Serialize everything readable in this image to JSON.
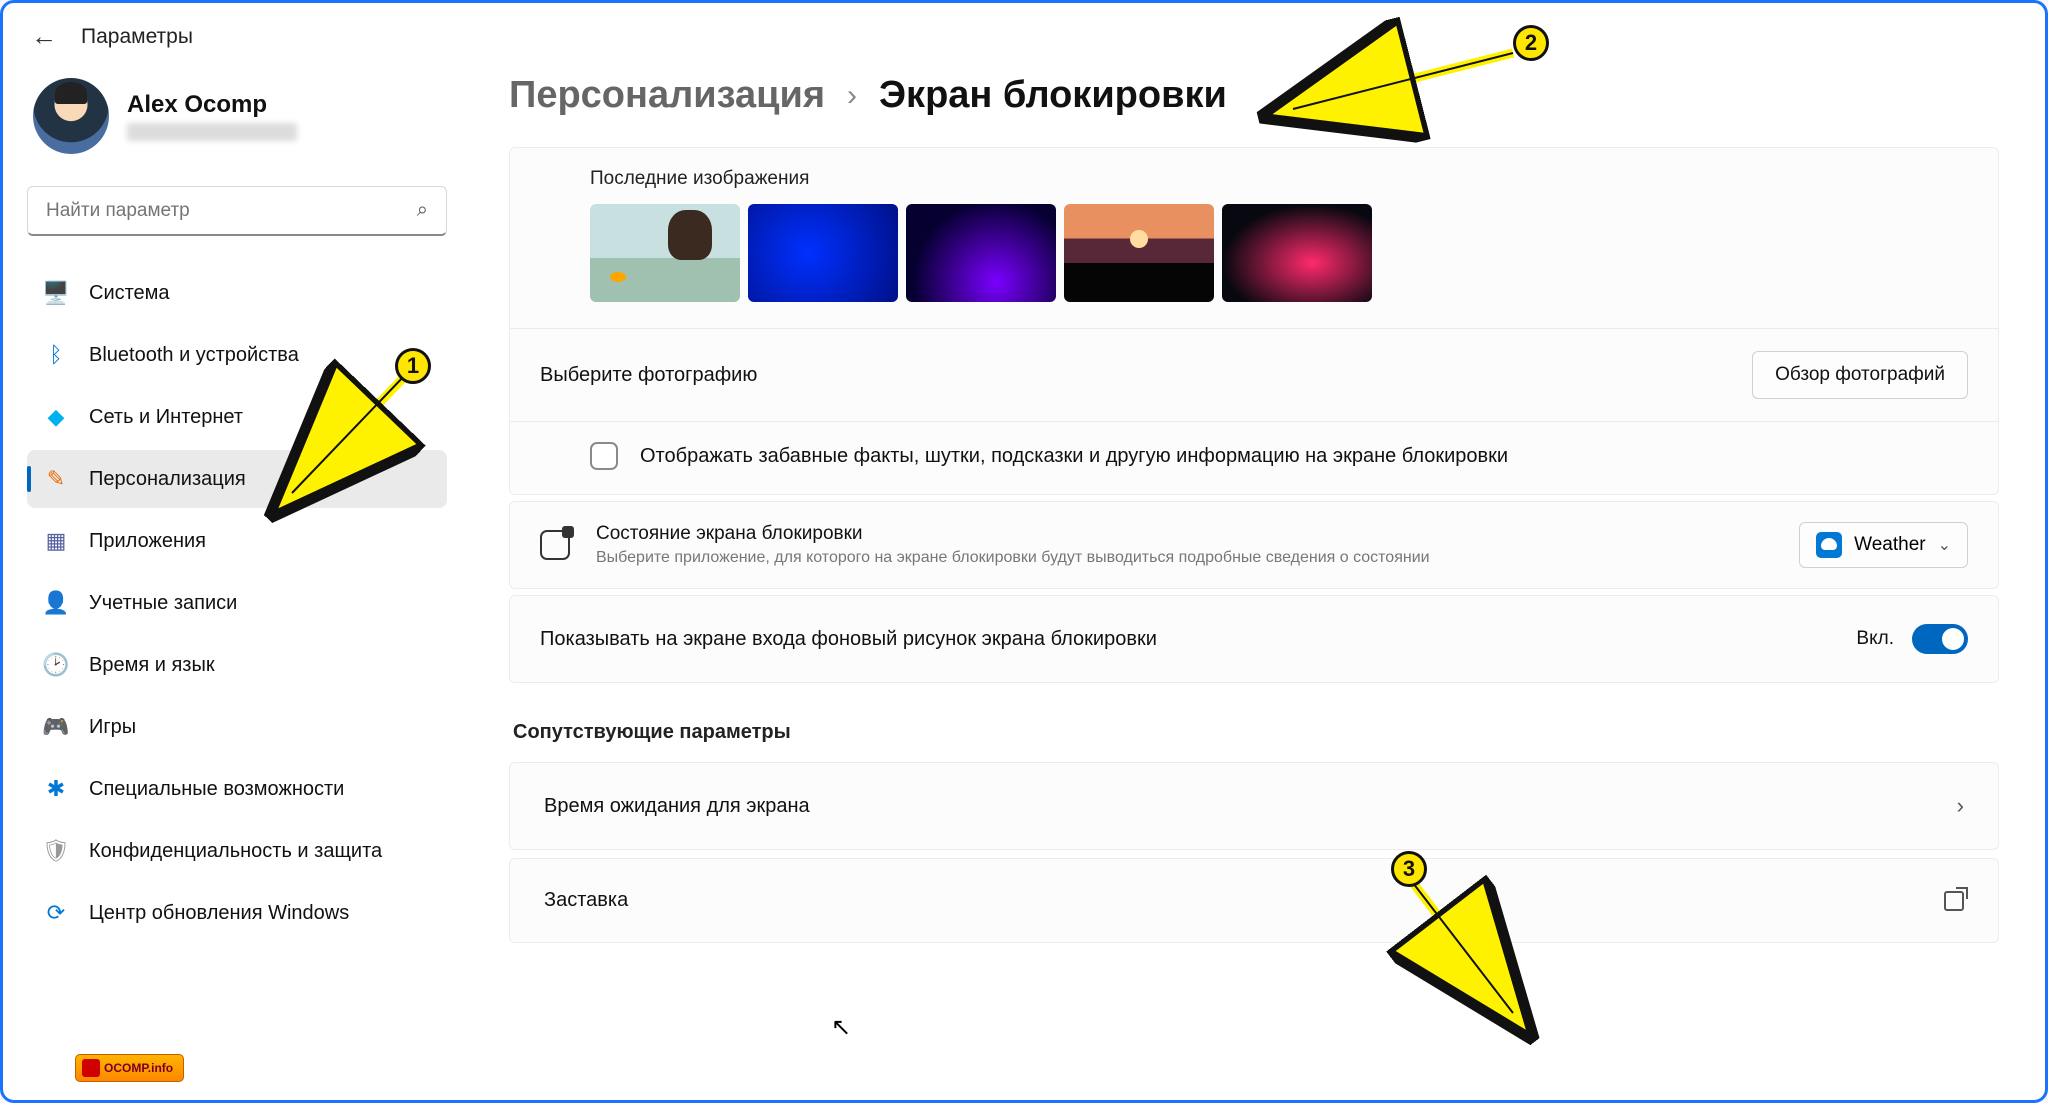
{
  "app_title": "Параметры",
  "profile": {
    "name": "Alex Ocomp"
  },
  "search": {
    "placeholder": "Найти параметр"
  },
  "nav": [
    {
      "label": "Система",
      "icon": "🖥️",
      "color": "#0078d4"
    },
    {
      "label": "Bluetooth и устройства",
      "icon": "ᛒ",
      "color": "#0078d4"
    },
    {
      "label": "Сеть и Интернет",
      "icon": "◆",
      "color": "#00b0f0"
    },
    {
      "label": "Персонализация",
      "icon": "✎",
      "color": "#e86c0a",
      "active": true
    },
    {
      "label": "Приложения",
      "icon": "▦",
      "color": "#5560a0"
    },
    {
      "label": "Учетные записи",
      "icon": "👤",
      "color": "#2088c0"
    },
    {
      "label": "Время и язык",
      "icon": "🕑",
      "color": "#a08020"
    },
    {
      "label": "Игры",
      "icon": "🎮",
      "color": "#888"
    },
    {
      "label": "Специальные возможности",
      "icon": "✱",
      "color": "#0078d4"
    },
    {
      "label": "Конфиденциальность и защита",
      "icon": "🛡",
      "color": "#999"
    },
    {
      "label": "Центр обновления Windows",
      "icon": "⟳",
      "color": "#0078d4"
    }
  ],
  "breadcrumb": {
    "parent": "Персонализация",
    "current": "Экран блокировки"
  },
  "recent_images_label": "Последние изображения",
  "choose_photo_label": "Выберите фотографию",
  "browse_button": "Обзор фотографий",
  "facts_checkbox": "Отображать забавные факты, шутки, подсказки и другую информацию на экране блокировки",
  "status": {
    "title": "Состояние экрана блокировки",
    "desc": "Выберите приложение, для которого на экране блокировки будут выводиться подробные сведения о состоянии",
    "selected": "Weather"
  },
  "signin_bg": {
    "label": "Показывать на экране входа фоновый рисунок экрана блокировки",
    "state": "Вкл."
  },
  "related_header": "Сопутствующие параметры",
  "related": [
    {
      "label": "Время ожидания для экрана"
    },
    {
      "label": "Заставка"
    }
  ],
  "annotations": {
    "m1": "1",
    "m2": "2",
    "m3": "3"
  },
  "watermark": "OCOMP.info"
}
